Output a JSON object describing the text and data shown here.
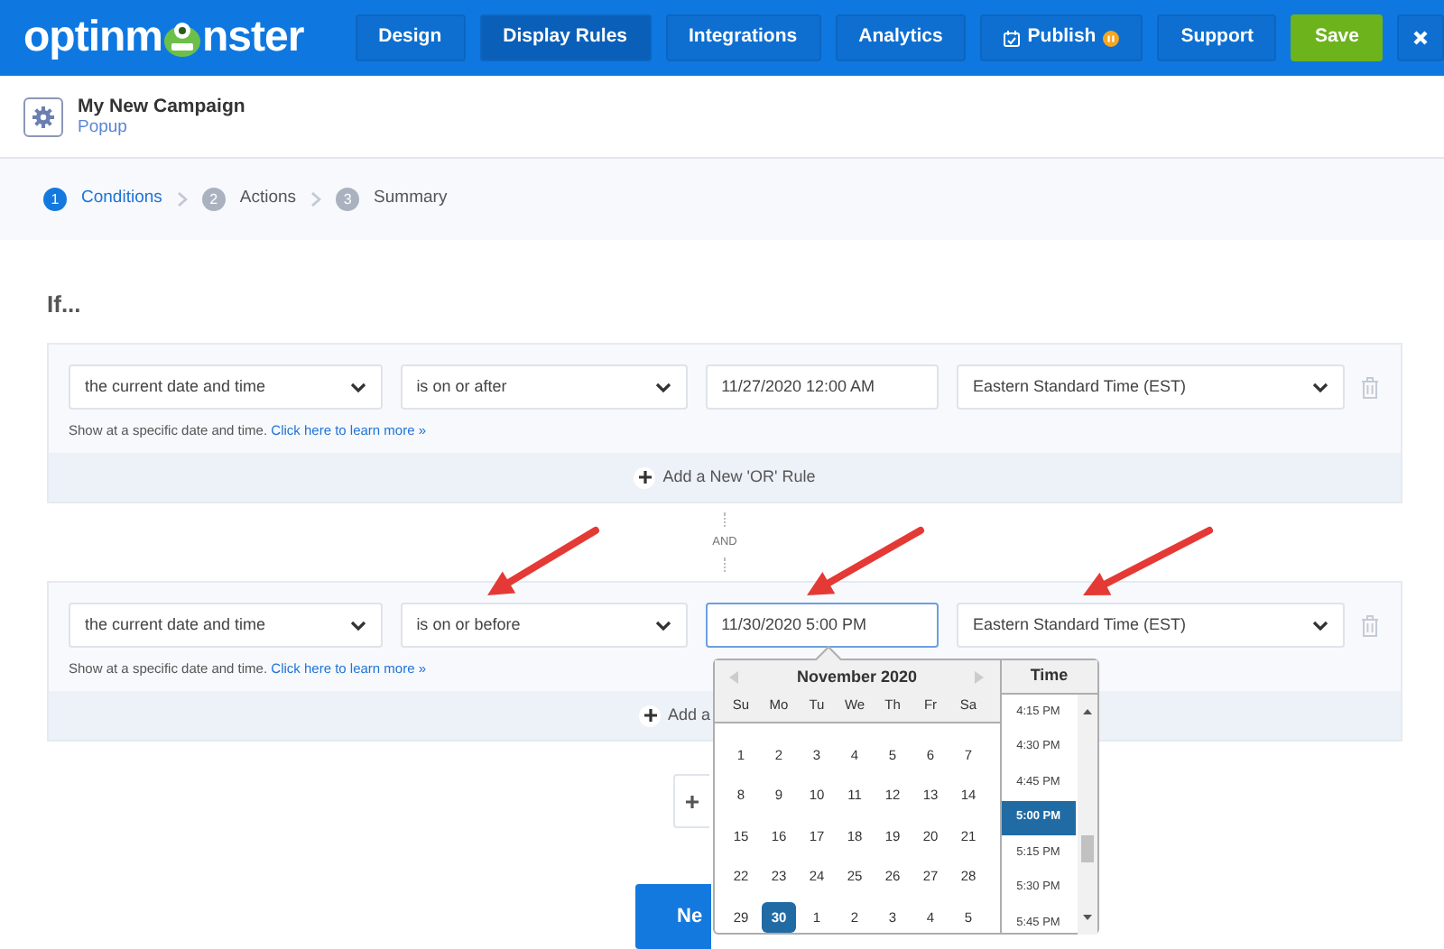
{
  "logo": {
    "text_before": "optinm",
    "text_after": "nster"
  },
  "nav": [
    {
      "kind": "tab",
      "label": "Design",
      "selected": false
    },
    {
      "kind": "tab",
      "label": "Display Rules",
      "selected": true
    },
    {
      "kind": "tab",
      "label": "Integrations",
      "selected": false
    },
    {
      "kind": "tab",
      "label": "Analytics",
      "selected": false
    },
    {
      "kind": "publish",
      "label": "Publish",
      "selected": false
    },
    {
      "kind": "tab",
      "label": "Support",
      "selected": false
    },
    {
      "kind": "save",
      "label": "Save",
      "selected": false
    },
    {
      "kind": "close",
      "selected": false
    }
  ],
  "campaign": {
    "title": "My New Campaign",
    "type": "Popup"
  },
  "steps": [
    {
      "number": "1",
      "label": "Conditions",
      "selected": true
    },
    {
      "number": "2",
      "label": "Actions",
      "selected": false
    },
    {
      "number": "3",
      "label": "Summary",
      "selected": false
    }
  ],
  "heading": "If...",
  "rules": [
    {
      "field": "the current date and time",
      "operator": "is on or after",
      "value": "11/27/2020 12:00 AM",
      "focused": false,
      "timezone": "Eastern Standard Time (EST)",
      "help": "Show at a specific date and time.",
      "help_link": "Click here to learn more »",
      "add_or": "Add a New 'OR' Rule"
    },
    {
      "field": "the current date and time",
      "operator": "is on or before",
      "value": "11/30/2020 5:00 PM",
      "focused": true,
      "timezone": "Eastern Standard Time (EST)",
      "help": "Show at a specific date and time.",
      "help_link": "Click here to learn more »",
      "add_or": "Add a"
    }
  ],
  "connector": "AND",
  "next_button": "Ne",
  "date_picker": {
    "month": "November 2020",
    "weekdays": [
      "Su",
      "Mo",
      "Tu",
      "We",
      "Th",
      "Fr",
      "Sa"
    ],
    "weeks": [
      [
        {
          "label": "1",
          "selected": false
        },
        {
          "label": "2",
          "selected": false
        },
        {
          "label": "3",
          "selected": false
        },
        {
          "label": "4",
          "selected": false
        },
        {
          "label": "5",
          "selected": false
        },
        {
          "label": "6",
          "selected": false
        },
        {
          "label": "7",
          "selected": false
        }
      ],
      [
        {
          "label": "8",
          "selected": false
        },
        {
          "label": "9",
          "selected": false
        },
        {
          "label": "10",
          "selected": false
        },
        {
          "label": "11",
          "selected": false
        },
        {
          "label": "12",
          "selected": false
        },
        {
          "label": "13",
          "selected": false
        },
        {
          "label": "14",
          "selected": false
        }
      ],
      [
        {
          "label": "15",
          "selected": false
        },
        {
          "label": "16",
          "selected": false
        },
        {
          "label": "17",
          "selected": false
        },
        {
          "label": "18",
          "selected": false
        },
        {
          "label": "19",
          "selected": false
        },
        {
          "label": "20",
          "selected": false
        },
        {
          "label": "21",
          "selected": false
        }
      ],
      [
        {
          "label": "22",
          "selected": false
        },
        {
          "label": "23",
          "selected": false
        },
        {
          "label": "24",
          "selected": false
        },
        {
          "label": "25",
          "selected": false
        },
        {
          "label": "26",
          "selected": false
        },
        {
          "label": "27",
          "selected": false
        },
        {
          "label": "28",
          "selected": false
        }
      ],
      [
        {
          "label": "29",
          "selected": false
        },
        {
          "label": "30",
          "selected": true
        },
        {
          "label": "1",
          "selected": false
        },
        {
          "label": "2",
          "selected": false
        },
        {
          "label": "3",
          "selected": false
        },
        {
          "label": "4",
          "selected": false
        },
        {
          "label": "5",
          "selected": false
        }
      ]
    ],
    "time_header": "Time",
    "times": [
      {
        "label": "4:15 PM",
        "selected": false
      },
      {
        "label": "4:30 PM",
        "selected": false
      },
      {
        "label": "4:45 PM",
        "selected": false
      },
      {
        "label": "5:00 PM",
        "selected": true
      },
      {
        "label": "5:15 PM",
        "selected": false
      },
      {
        "label": "5:30 PM",
        "selected": false
      },
      {
        "label": "5:45 PM",
        "selected": false
      }
    ]
  }
}
